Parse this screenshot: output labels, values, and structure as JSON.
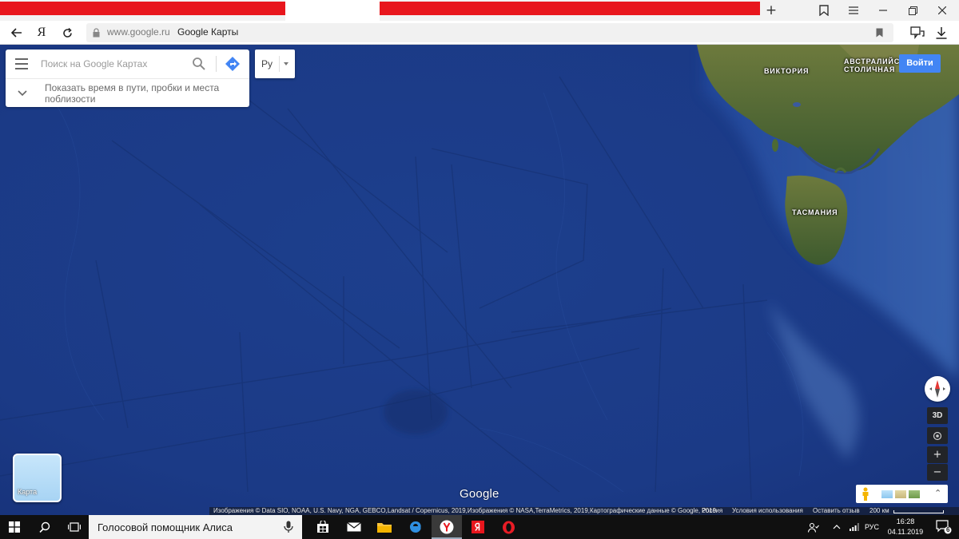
{
  "browser": {
    "url_domain": "www.google.ru",
    "page_title": "Google Карты"
  },
  "map": {
    "search": {
      "placeholder": "Поиск на Google Картах",
      "hint": "Показать время в пути, пробки и места поблизости"
    },
    "language": "Ру",
    "sign_in": "Войти",
    "labels": {
      "australia": "АВСТРАЛИЙС",
      "capital": "СТОЛИЧНАЯ",
      "victoria": "ВИКТОРИЯ",
      "tasmania": "ТАСМАНИЯ"
    },
    "thumbnail_label": "Карта",
    "google_logo": "Google",
    "controls": {
      "three_d": "3D",
      "zoom_in": "+",
      "zoom_out": "−"
    },
    "attribution": {
      "imagery": "Изображения © Data SIO, NOAA, U.S. Navy, NGA, GEBCO,Landsat / Copernicus, 2019,Изображения © NASA,TerraMetrics, 2019,Картографические данные © Google, 2019",
      "country": "Россия",
      "terms": "Условия использования",
      "feedback": "Оставить отзыв",
      "scale": "200 км"
    }
  },
  "taskbar": {
    "assistant_text": "Голосовой помощник Алиса",
    "language": "РУС",
    "time": "16:28",
    "date": "04.11.2019",
    "notification_count": "6"
  }
}
